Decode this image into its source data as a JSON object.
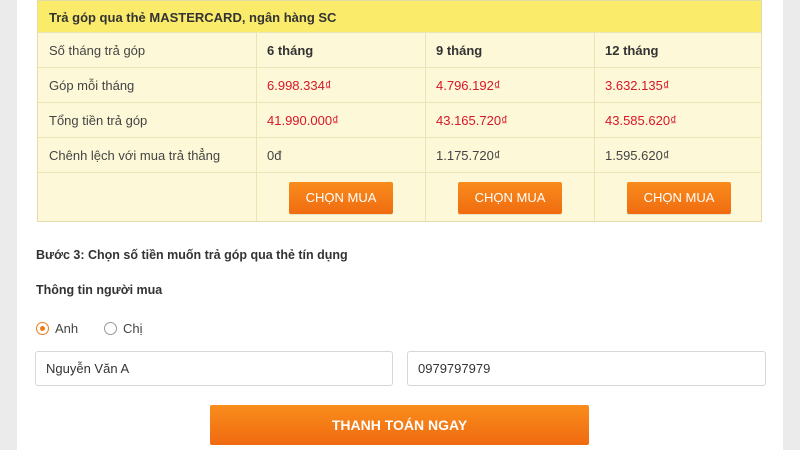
{
  "plan": {
    "header": "Trả góp qua thẻ MASTERCARD, ngân hàng SC",
    "rows": [
      {
        "label": "Số tháng trả góp",
        "values": [
          "6 tháng",
          "9 tháng",
          "12 tháng"
        ]
      },
      {
        "label": "Góp mỗi tháng",
        "values": [
          "6.998.334₫",
          "4.796.192₫",
          "3.632.135₫"
        ]
      },
      {
        "label": "Tổng tiền trả góp",
        "values": [
          "41.990.000₫",
          "43.165.720₫",
          "43.585.620₫"
        ]
      },
      {
        "label": "Chênh lệch với mua trả thẳng",
        "values": [
          "0đ",
          "1.175.720₫",
          "1.595.620₫"
        ]
      }
    ],
    "buy_label": "CHỌN MUA"
  },
  "step3": {
    "title": "Bước 3: Chọn số tiền muốn trả góp qua thẻ tín dụng"
  },
  "buyer": {
    "title": "Thông tin người mua",
    "gender_options": [
      "Anh",
      "Chị"
    ],
    "selected_gender": "Anh",
    "name_value": "Nguyễn Văn A",
    "phone_value": "0979797979"
  },
  "pay_button": "THANH TOÁN NGAY",
  "colors": {
    "header_bg": "#fbeb6a",
    "row_bg": "#fdf8d7",
    "accent_orange": "#f7841a",
    "price_red": "#d8162a"
  }
}
